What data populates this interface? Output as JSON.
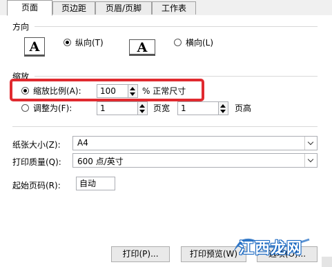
{
  "tabs": [
    "页面",
    "页边距",
    "页眉/页脚",
    "工作表"
  ],
  "orientation": {
    "section_label": "方向",
    "portrait_label": "纵向(T)",
    "landscape_label": "横向(L)",
    "portrait_icon_letter": "A",
    "landscape_icon_letter": "A",
    "selected": "portrait"
  },
  "scaling": {
    "section_label": "缩放",
    "scale_label": "缩放比例(A):",
    "scale_value": "100",
    "scale_unit": "% 正常尺寸",
    "fit_label": "调整为(F):",
    "fit_wide_value": "1",
    "fit_wide_unit": "页宽",
    "fit_tall_value": "1",
    "fit_tall_unit": "页高",
    "selected": "scale"
  },
  "paper": {
    "size_label": "纸张大小(Z):",
    "size_value": "A4",
    "quality_label": "打印质量(Q):",
    "quality_value": "600 点/英寸",
    "first_page_label": "起始页码(R):",
    "first_page_value": "自动"
  },
  "buttons": {
    "print": "打印(P)...",
    "preview": "打印预览(W)",
    "options": "选项(O)..."
  },
  "watermark": {
    "text": "江西龙网"
  },
  "colors": {
    "highlight": "#e02a2f",
    "watermark_bg": "#1565c0"
  }
}
